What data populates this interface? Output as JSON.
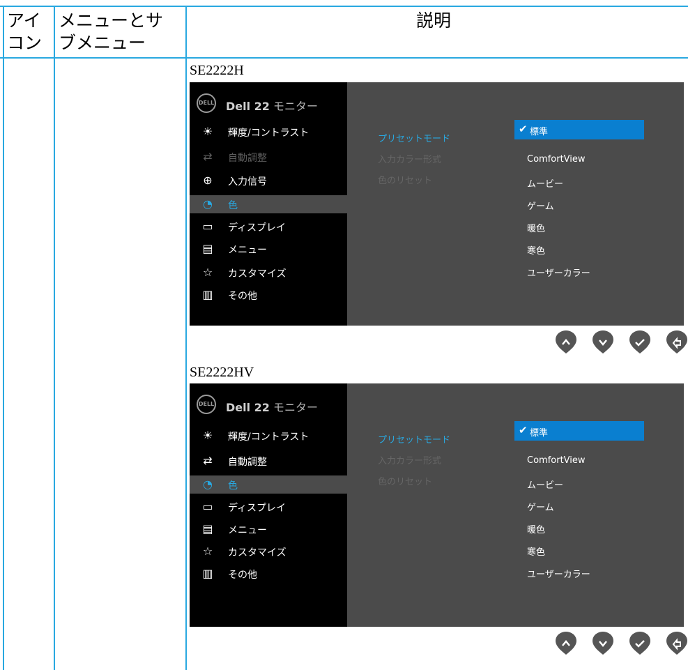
{
  "table": {
    "headers": {
      "icon": "アイコン",
      "menu": "メニューとサブメニュー",
      "description": "説明"
    },
    "header_lines": {
      "icon_1": "アイ",
      "icon_2": "コン",
      "menu_1": "メニューとサ",
      "menu_2": "ブメニュー"
    }
  },
  "colors": {
    "accent": "#29a8e0",
    "selection": "#0a7fd0",
    "osd_panel": "#4b4b4b",
    "osd_menu": "#000000"
  },
  "osd_sections": [
    {
      "model": "SE2222H",
      "logo": "DELL",
      "title_brand": "Dell 22",
      "title_rest": " モニター",
      "menu": [
        {
          "icon": "brightness-icon",
          "glyph": "☀",
          "label": "輝度/コントラスト",
          "state": "normal"
        },
        {
          "icon": "auto-adjust-icon",
          "glyph": "⇄",
          "label": "自動調整",
          "state": "disabled"
        },
        {
          "icon": "input-source-icon",
          "glyph": "⊕",
          "label": "入力信号",
          "state": "normal"
        },
        {
          "icon": "color-icon",
          "glyph": "◔",
          "label": "色",
          "state": "selected"
        },
        {
          "icon": "display-icon",
          "glyph": "▭",
          "label": "ディスプレイ",
          "state": "normal"
        },
        {
          "icon": "menu-icon",
          "glyph": "▤",
          "label": "メニュー",
          "state": "normal"
        },
        {
          "icon": "personalize-icon",
          "glyph": "☆",
          "label": "カスタマイズ",
          "state": "normal"
        },
        {
          "icon": "others-icon",
          "glyph": "▥",
          "label": "その他",
          "state": "normal"
        }
      ],
      "submenu": [
        "プリセットモード",
        "入力カラー形式",
        "色のリセット"
      ],
      "options": [
        "標準",
        "ComfortView",
        "ムービー",
        "ゲーム",
        "暖色",
        "寒色",
        "ユーザーカラー"
      ],
      "selected_option": "標準",
      "buttons": [
        "up-icon",
        "down-icon",
        "check-icon",
        "back-icon"
      ]
    },
    {
      "model": "SE2222HV",
      "logo": "DELL",
      "title_brand": "Dell 22",
      "title_rest": " モニター",
      "menu": [
        {
          "icon": "brightness-icon",
          "glyph": "☀",
          "label": "輝度/コントラスト",
          "state": "normal"
        },
        {
          "icon": "auto-adjust-icon",
          "glyph": "⇄",
          "label": "自動調整",
          "state": "normal"
        },
        {
          "icon": "color-icon",
          "glyph": "◔",
          "label": "色",
          "state": "selected"
        },
        {
          "icon": "display-icon",
          "glyph": "▭",
          "label": "ディスプレイ",
          "state": "normal"
        },
        {
          "icon": "menu-icon",
          "glyph": "▤",
          "label": "メニュー",
          "state": "normal"
        },
        {
          "icon": "personalize-icon",
          "glyph": "☆",
          "label": "カスタマイズ",
          "state": "normal"
        },
        {
          "icon": "others-icon",
          "glyph": "▥",
          "label": "その他",
          "state": "normal"
        }
      ],
      "submenu": [
        "プリセットモード",
        "入力カラー形式",
        "色のリセット"
      ],
      "options": [
        "標準",
        "ComfortView",
        "ムービー",
        "ゲーム",
        "暖色",
        "寒色",
        "ユーザーカラー"
      ],
      "selected_option": "標準",
      "buttons": [
        "up-icon",
        "down-icon",
        "check-icon",
        "back-icon"
      ]
    }
  ]
}
